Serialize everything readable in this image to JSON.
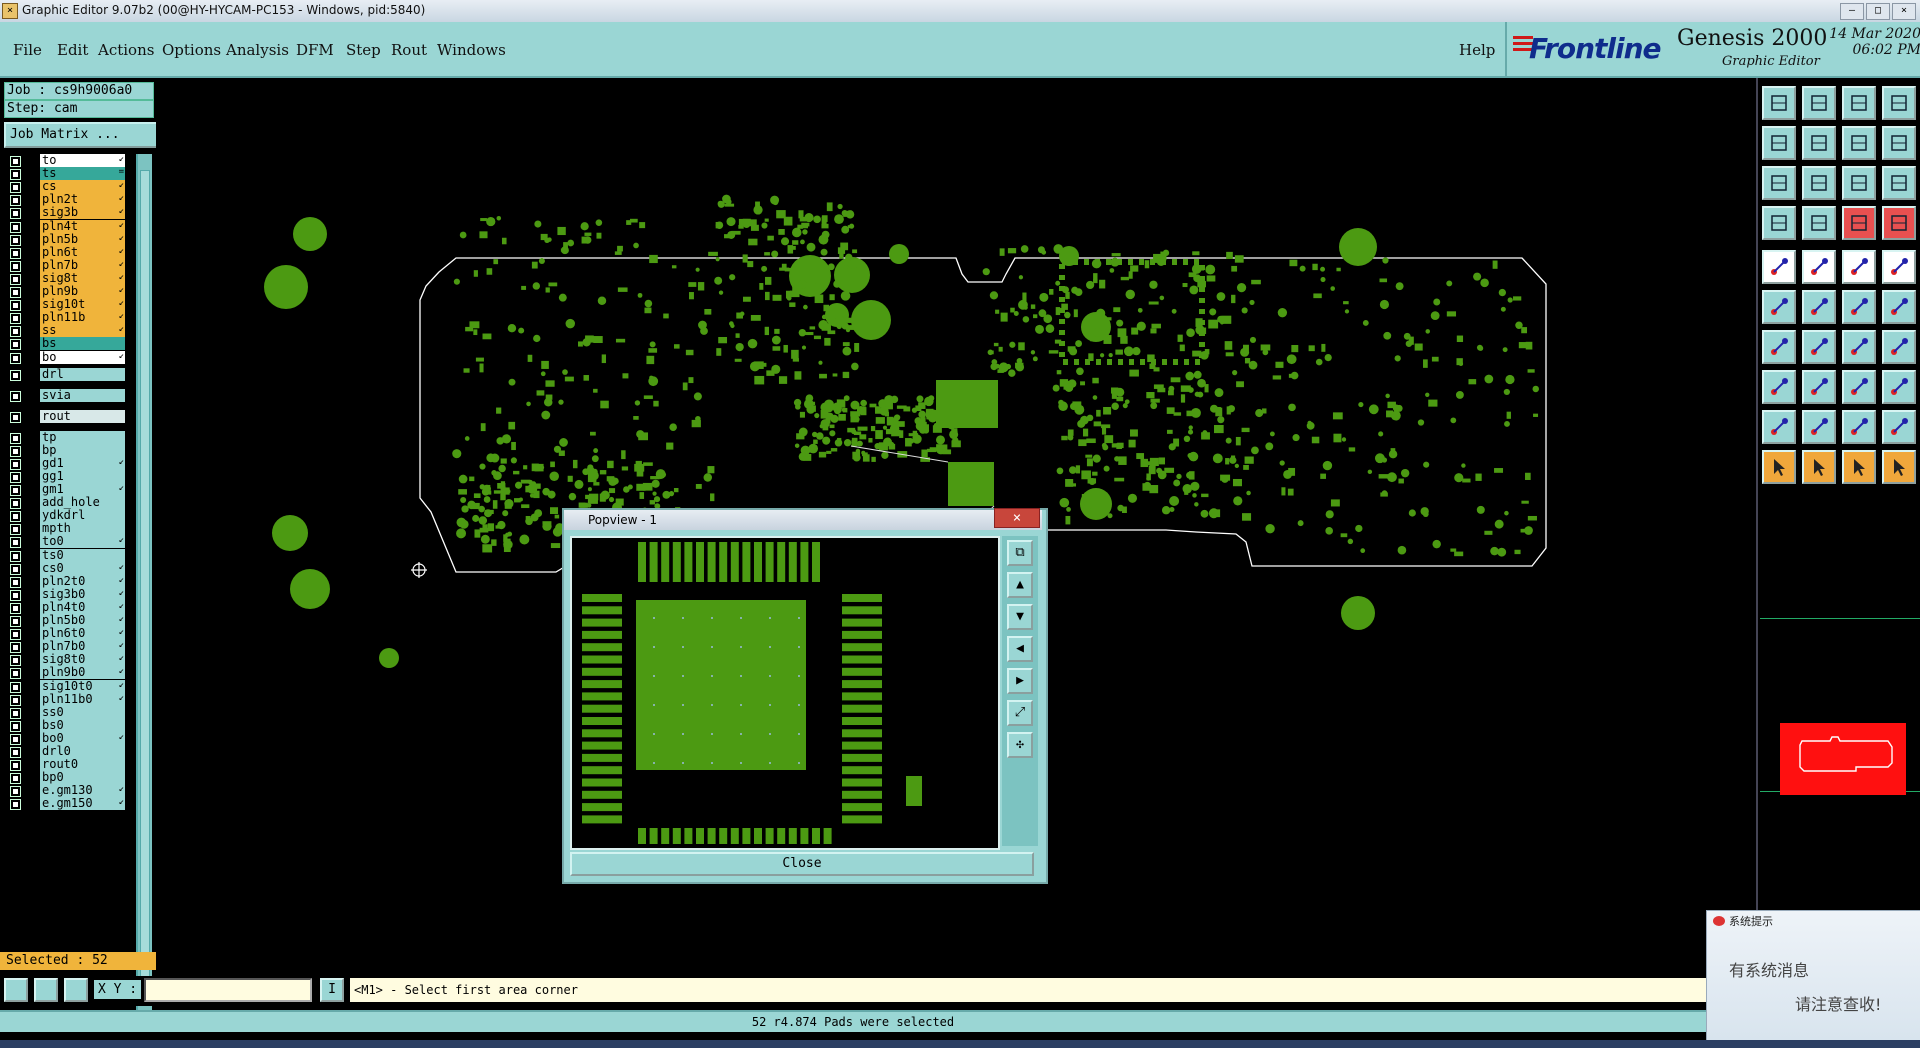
{
  "window": {
    "title": "Graphic Editor 9.07b2 (00@HY-HYCAM-PC153 - Windows, pid:5840)"
  },
  "menu": {
    "items": [
      "File",
      "Edit",
      "Actions",
      "Options",
      "Analysis",
      "DFM",
      "Step",
      "Rout",
      "Windows"
    ],
    "help": "Help"
  },
  "brand": {
    "logo": "Frontline",
    "product": "Genesis 2000",
    "subtitle": "Graphic Editor",
    "date": "14 Mar 2020",
    "time": "06:02 PM"
  },
  "job": {
    "job_label": "Job : cs9h9006a0",
    "step_label": "Step: cam",
    "matrix_button": "Job Matrix ..."
  },
  "layers": [
    {
      "name": "to",
      "color": "#ffffff",
      "arrow": "↙"
    },
    {
      "name": "ts",
      "color": "#36a89a",
      "arrow": "="
    },
    {
      "name": "cs",
      "color": "#f0b43b",
      "arrow": "↙"
    },
    {
      "name": "pln2t",
      "color": "#f0b43b",
      "arrow": "↙"
    },
    {
      "name": "sig3b",
      "color": "#f0b43b",
      "arrow": "↙"
    },
    {
      "name": "pln4t",
      "color": "#f0b43b",
      "arrow": "↙"
    },
    {
      "name": "pln5b",
      "color": "#f0b43b",
      "arrow": "↙"
    },
    {
      "name": "pln6t",
      "color": "#f0b43b",
      "arrow": "↙"
    },
    {
      "name": "pln7b",
      "color": "#f0b43b",
      "arrow": "↙"
    },
    {
      "name": "sig8t",
      "color": "#f0b43b",
      "arrow": "↙"
    },
    {
      "name": "pln9b",
      "color": "#f0b43b",
      "arrow": "↙"
    },
    {
      "name": "sig10t",
      "color": "#f0b43b",
      "arrow": "↙"
    },
    {
      "name": "pln11b",
      "color": "#f0b43b",
      "arrow": "↙"
    },
    {
      "name": "ss",
      "color": "#f0b43b",
      "arrow": "↙"
    },
    {
      "name": "bs",
      "color": "#36a89a",
      "arrow": ""
    },
    {
      "name": "bo",
      "color": "#ffffff",
      "arrow": "↙"
    },
    {
      "name": "drl",
      "color": "#9ad6d4",
      "arrow": "",
      "gap": true
    },
    {
      "name": "svia",
      "color": "#9ad6d4",
      "arrow": "",
      "gap": true
    },
    {
      "name": "rout",
      "color": "#d8e8e8",
      "arrow": "",
      "gap": true
    },
    {
      "name": "tp",
      "color": "#9ad6d4",
      "arrow": "",
      "gap": true
    },
    {
      "name": "bp",
      "color": "#9ad6d4",
      "arrow": ""
    },
    {
      "name": "gd1",
      "color": "#9ad6d4",
      "arrow": "↙"
    },
    {
      "name": "gg1",
      "color": "#9ad6d4",
      "arrow": ""
    },
    {
      "name": "gm1",
      "color": "#9ad6d4",
      "arrow": "↙"
    },
    {
      "name": "add_hole",
      "color": "#9ad6d4",
      "arrow": ""
    },
    {
      "name": "ydkdrl",
      "color": "#9ad6d4",
      "arrow": ""
    },
    {
      "name": "mpth",
      "color": "#9ad6d4",
      "arrow": ""
    },
    {
      "name": "to0",
      "color": "#9ad6d4",
      "arrow": "↙"
    },
    {
      "name": "ts0",
      "color": "#9ad6d4",
      "arrow": ""
    },
    {
      "name": "cs0",
      "color": "#9ad6d4",
      "arrow": "↙"
    },
    {
      "name": "pln2t0",
      "color": "#9ad6d4",
      "arrow": "↙"
    },
    {
      "name": "sig3b0",
      "color": "#9ad6d4",
      "arrow": "↙"
    },
    {
      "name": "pln4t0",
      "color": "#9ad6d4",
      "arrow": "↙"
    },
    {
      "name": "pln5b0",
      "color": "#9ad6d4",
      "arrow": "↙"
    },
    {
      "name": "pln6t0",
      "color": "#9ad6d4",
      "arrow": "↙"
    },
    {
      "name": "pln7b0",
      "color": "#9ad6d4",
      "arrow": "↙"
    },
    {
      "name": "sig8t0",
      "color": "#9ad6d4",
      "arrow": "↙"
    },
    {
      "name": "pln9b0",
      "color": "#9ad6d4",
      "arrow": "↙"
    },
    {
      "name": "sig10t0",
      "color": "#9ad6d4",
      "arrow": "↙"
    },
    {
      "name": "pln11b0",
      "color": "#9ad6d4",
      "arrow": "↙"
    },
    {
      "name": "ss0",
      "color": "#9ad6d4",
      "arrow": ""
    },
    {
      "name": "bs0",
      "color": "#9ad6d4",
      "arrow": ""
    },
    {
      "name": "bo0",
      "color": "#9ad6d4",
      "arrow": "↙"
    },
    {
      "name": "drl0",
      "color": "#9ad6d4",
      "arrow": ""
    },
    {
      "name": "rout0",
      "color": "#9ad6d4",
      "arrow": ""
    },
    {
      "name": "bp0",
      "color": "#9ad6d4",
      "arrow": ""
    },
    {
      "name": "e.gm130",
      "color": "#9ad6d4",
      "arrow": "↙"
    },
    {
      "name": "e.gm150",
      "color": "#9ad6d4",
      "arrow": "↙"
    }
  ],
  "selection": {
    "label": "Selected : 52"
  },
  "popview": {
    "title": "Popview - 1",
    "close_label": "Close",
    "close_x": "×"
  },
  "command": {
    "xy_label": "X Y :",
    "xy_value": "",
    "info_button": "I",
    "prompt": "<M1> - Select first area corner"
  },
  "status": {
    "message": "52 r4.874 Pads were selected"
  },
  "notification": {
    "title": "系统提示",
    "line1": "有系统消息",
    "line2": "请注意查收!"
  },
  "colors": {
    "panel": "#9ad6d4",
    "copper": "#4c9a12",
    "outline": "#ffffff",
    "orange": "#f0b43b",
    "teal": "#36a89a"
  }
}
